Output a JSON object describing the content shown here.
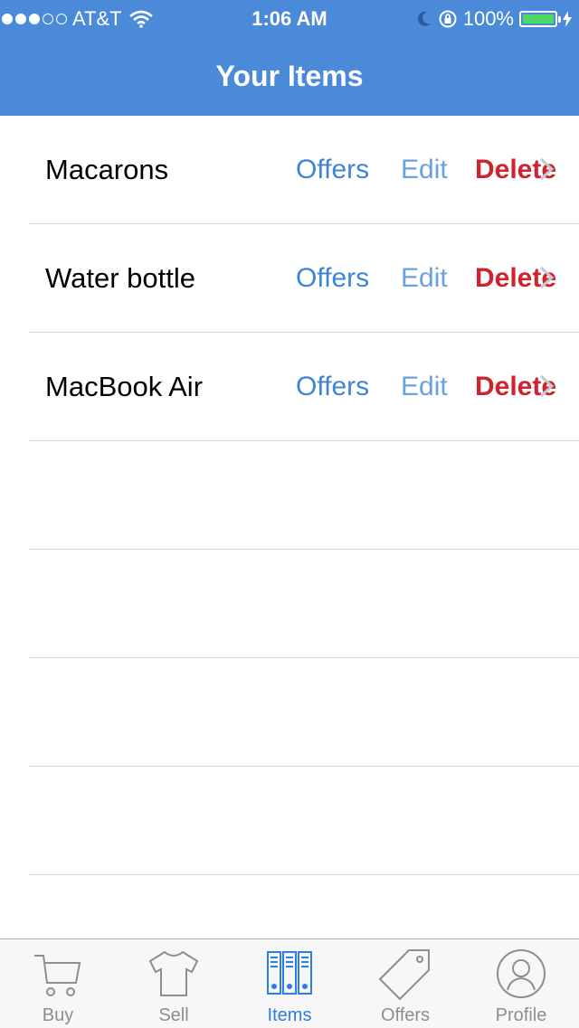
{
  "status_bar": {
    "carrier": "AT&T",
    "time": "1:06 AM",
    "battery": "100%"
  },
  "nav": {
    "title": "Your Items"
  },
  "items": [
    {
      "name": "Macarons",
      "offers": "Offers",
      "edit": "Edit",
      "delete": "Delete"
    },
    {
      "name": "Water bottle",
      "offers": "Offers",
      "edit": "Edit",
      "delete": "Delete"
    },
    {
      "name": "MacBook Air",
      "offers": "Offers",
      "edit": "Edit",
      "delete": "Delete"
    }
  ],
  "tabs": [
    {
      "label": "Buy",
      "icon": "cart-icon"
    },
    {
      "label": "Sell",
      "icon": "shirt-icon"
    },
    {
      "label": "Items",
      "icon": "binders-icon",
      "active": true
    },
    {
      "label": "Offers",
      "icon": "tag-icon"
    },
    {
      "label": "Profile",
      "icon": "person-icon"
    }
  ],
  "colors": {
    "header": "#4a8ad8",
    "link": "#3d85d6",
    "delete": "#d0232e",
    "active_tab": "#2a7de1"
  }
}
